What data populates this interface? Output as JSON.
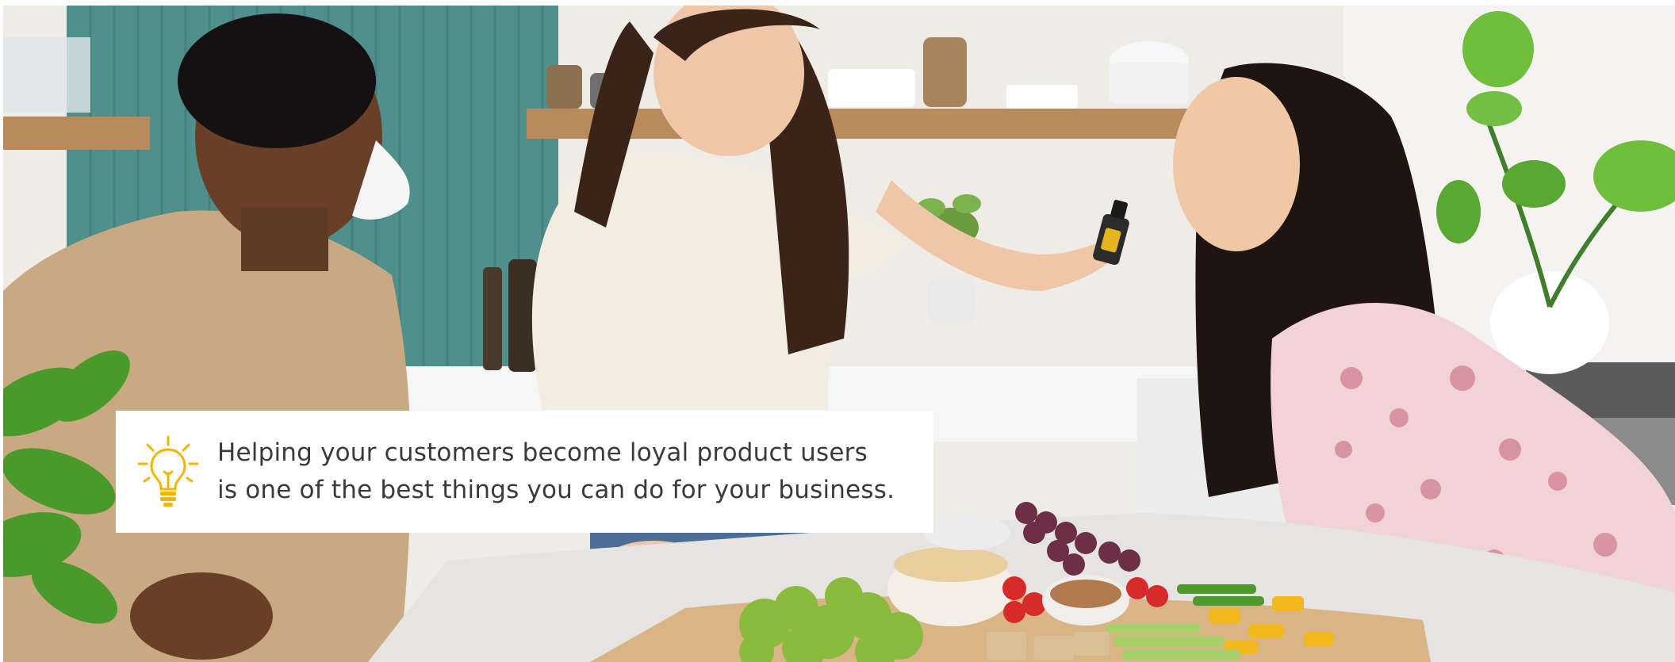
{
  "banner": {
    "photo_description_icon": "kitchen-photo",
    "callout": {
      "icon": "lightbulb-icon",
      "line1": "Helping your customers become loyal product users",
      "line2": "is one of the best things you can do for your business."
    },
    "colors": {
      "bulb": "#f5b400",
      "text": "#3a3a3a",
      "callout_bg": "#ffffff",
      "tile_teal": "#4f8f8c"
    }
  }
}
